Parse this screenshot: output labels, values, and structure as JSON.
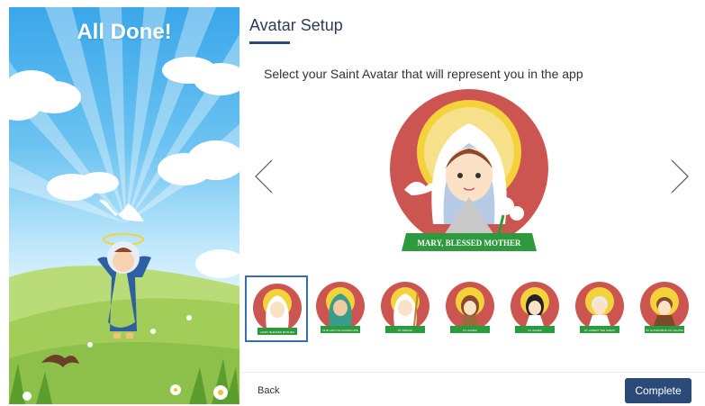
{
  "left_panel": {
    "title": "All Done!"
  },
  "header": {
    "title": "Avatar Setup"
  },
  "instruction": "Select your Saint Avatar that will represent you in the app",
  "selected_avatar": {
    "banner_label": "MARY, BLESSED MOTHER"
  },
  "thumbnails": [
    {
      "label": "MARY, BLESSED MOTHER",
      "selected": true
    },
    {
      "label": "OUR LADY OF GUADALUPE",
      "selected": false
    },
    {
      "label": "ST. ABIGAIL",
      "selected": false
    },
    {
      "label": "ST. AGNES",
      "selected": false
    },
    {
      "label": "ST. AGNES",
      "selected": false
    },
    {
      "label": "ST. ALBERT THE GREAT",
      "selected": false
    },
    {
      "label": "ST. ALPHONSUS OF LIGUORI",
      "selected": false
    }
  ],
  "footer": {
    "back_label": "Back",
    "complete_label": "Complete"
  },
  "colors": {
    "primary": "#2b4a77",
    "avatar_circle": "#cd5551",
    "banner_green": "#2e9a3e",
    "halo_yellow": "#f3d23c"
  }
}
